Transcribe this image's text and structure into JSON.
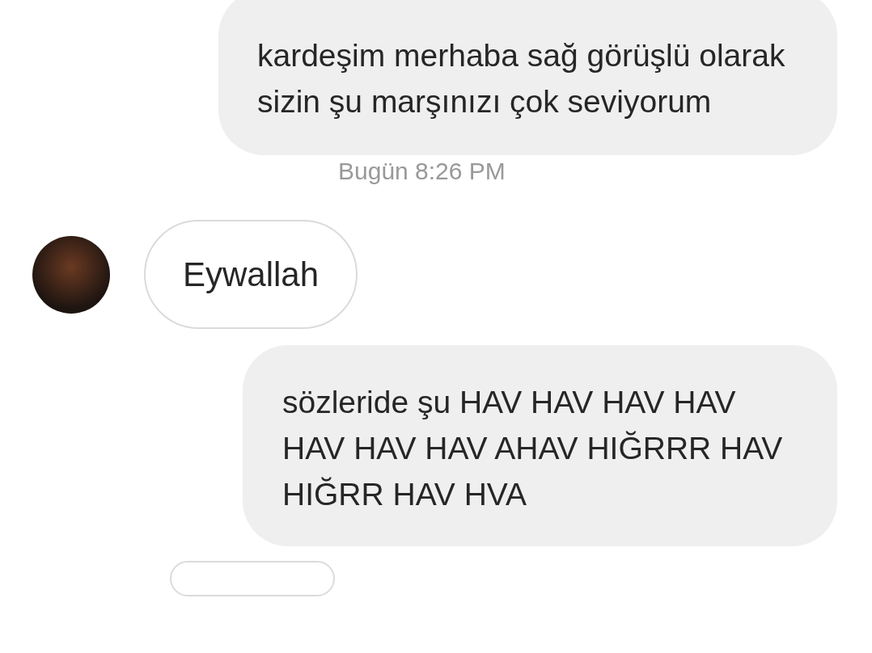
{
  "messages": [
    {
      "kind": "outgoing",
      "text": "kardeşim merhaba sağ görüşlü olarak sizin şu marşınızı çok seviyorum"
    },
    {
      "kind": "timestamp",
      "text": "Bugün 8:26 PM"
    },
    {
      "kind": "incoming",
      "text": "Eywallah"
    },
    {
      "kind": "outgoing",
      "text": "sözleride şu HAV HAV HAV HAV HAV HAV HAV AHAV HIĞRRR HAV HIĞRR HAV HVA"
    }
  ]
}
